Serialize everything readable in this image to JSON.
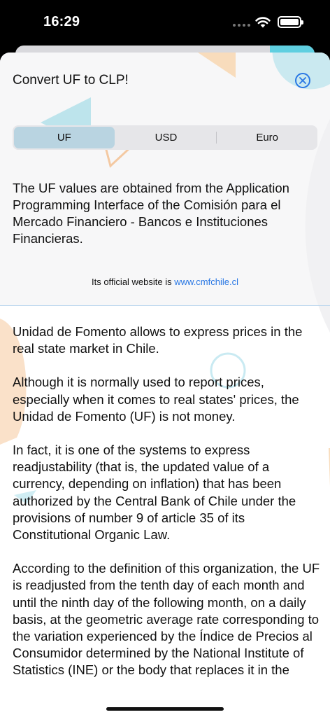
{
  "status_bar": {
    "time": "16:29"
  },
  "modal": {
    "title": "Convert UF to CLP!",
    "close_icon": "close-circle-icon",
    "accent_color": "#2a78e4",
    "segments": [
      {
        "label": "UF",
        "selected": true
      },
      {
        "label": "USD",
        "selected": false
      },
      {
        "label": "Euro",
        "selected": false
      }
    ],
    "info_text": "The UF values are obtained from the Application Programming Interface of the Comisión para el Mercado Financiero - Bancos e Instituciones Financieras.",
    "website_prefix": "Its official website is",
    "website_link": "www.cmfchile.cl"
  },
  "content": {
    "paragraphs": [
      "Unidad de Fomento allows to express prices in the real state market in Chile.",
      "Although it is normally used to report prices, especially when it comes to real states' prices, the Unidad de Fomento (UF) is not money.",
      "In fact, it is one of the systems to express readjustability (that is, the updated value of a currency, depending on inflation) that has been authorized by the Central Bank of Chile under the provisions of number 9 of article 35 of its Constitutional Organic Law.",
      "According to the definition of this organization, the UF is readjusted from the tenth day of each month and until the ninth day of the following month, on a daily basis, at the geometric average rate corresponding to the variation experienced by the Índice de Precios al Consumidor determined by the National Institute of Statistics (INE) or the body that replaces it in the calendar month immediately prior"
    ]
  }
}
